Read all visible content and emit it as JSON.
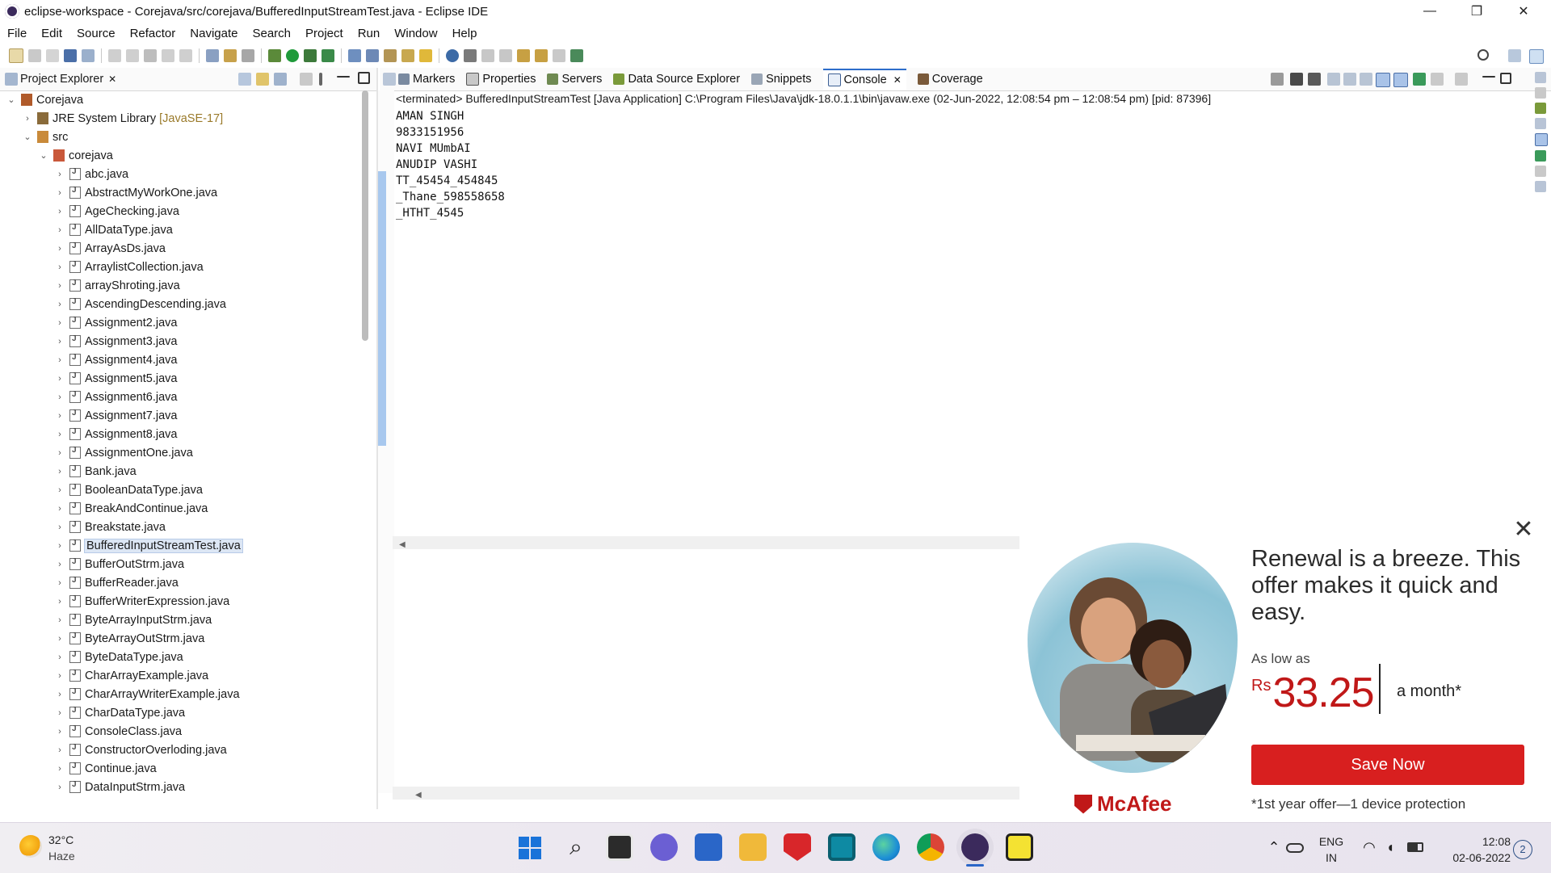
{
  "window": {
    "title": "eclipse-workspace - Corejava/src/corejava/BufferedInputStreamTest.java - Eclipse IDE",
    "minimize": "—",
    "restore": "❐",
    "close": "✕"
  },
  "menu": [
    "File",
    "Edit",
    "Source",
    "Refactor",
    "Navigate",
    "Search",
    "Project",
    "Run",
    "Window",
    "Help"
  ],
  "project_explorer": {
    "title": "Project Explorer",
    "close": "✕",
    "tree": {
      "project": "Corejava",
      "jre": "JRE System Library",
      "jre_version": "[JavaSE-17]",
      "src": "src",
      "package": "corejava",
      "files": [
        "abc.java",
        "AbstractMyWorkOne.java",
        "AgeChecking.java",
        "AllDataType.java",
        "ArrayAsDs.java",
        "ArraylistCollection.java",
        "arrayShroting.java",
        "AscendingDescending.java",
        "Assignment2.java",
        "Assignment3.java",
        "Assignment4.java",
        "Assignment5.java",
        "Assignment6.java",
        "Assignment7.java",
        "Assignment8.java",
        "AssignmentOne.java",
        "Bank.java",
        "BooleanDataType.java",
        "BreakAndContinue.java",
        "Breakstate.java",
        "BufferedInputStreamTest.java",
        "BufferOutStrm.java",
        "BufferReader.java",
        "BufferWriterExpression.java",
        "ByteArrayInputStrm.java",
        "ByteArrayOutStrm.java",
        "ByteDataType.java",
        "CharArrayExample.java",
        "CharArrayWriterExample.java",
        "CharDataType.java",
        "ConsoleClass.java",
        "ConstructorOverloding.java",
        "Continue.java",
        "DataInputStrm.java"
      ],
      "selected_index": 20
    }
  },
  "views": {
    "tabs": [
      "Markers",
      "Properties",
      "Servers",
      "Data Source Explorer",
      "Snippets",
      "Console",
      "Coverage"
    ],
    "active": "Console",
    "console_close": "✕"
  },
  "console": {
    "status": "<terminated> BufferedInputStreamTest [Java Application] C:\\Program Files\\Java\\jdk-18.0.1.1\\bin\\javaw.exe  (02-Jun-2022, 12:08:54 pm – 12:08:54 pm) [pid: 87396]",
    "lines": [
      "AMAN SINGH",
      "9833151956",
      "NAVI MUmbAI",
      "ANUDIP VASHI",
      "TT_45454_454845",
      "_Thane_598558658",
      "_HTHT_4545"
    ]
  },
  "ad": {
    "close": "✕",
    "headline": "Renewal is a breeze. This offer makes it quick and easy.",
    "as_low_as": "As low as",
    "currency": "Rs",
    "price": "33.25",
    "per": "a month*",
    "button": "Save Now",
    "logo": "McAfee",
    "footnote": "*1st year offer—1 device protection",
    "brand_color": "#d81f1f"
  },
  "taskbar": {
    "weather_temp": "32°C",
    "weather_cond": "Haze",
    "lang_top": "ENG",
    "lang_bottom": "IN",
    "time": "12:08",
    "date": "02-06-2022",
    "notifications": "2"
  }
}
